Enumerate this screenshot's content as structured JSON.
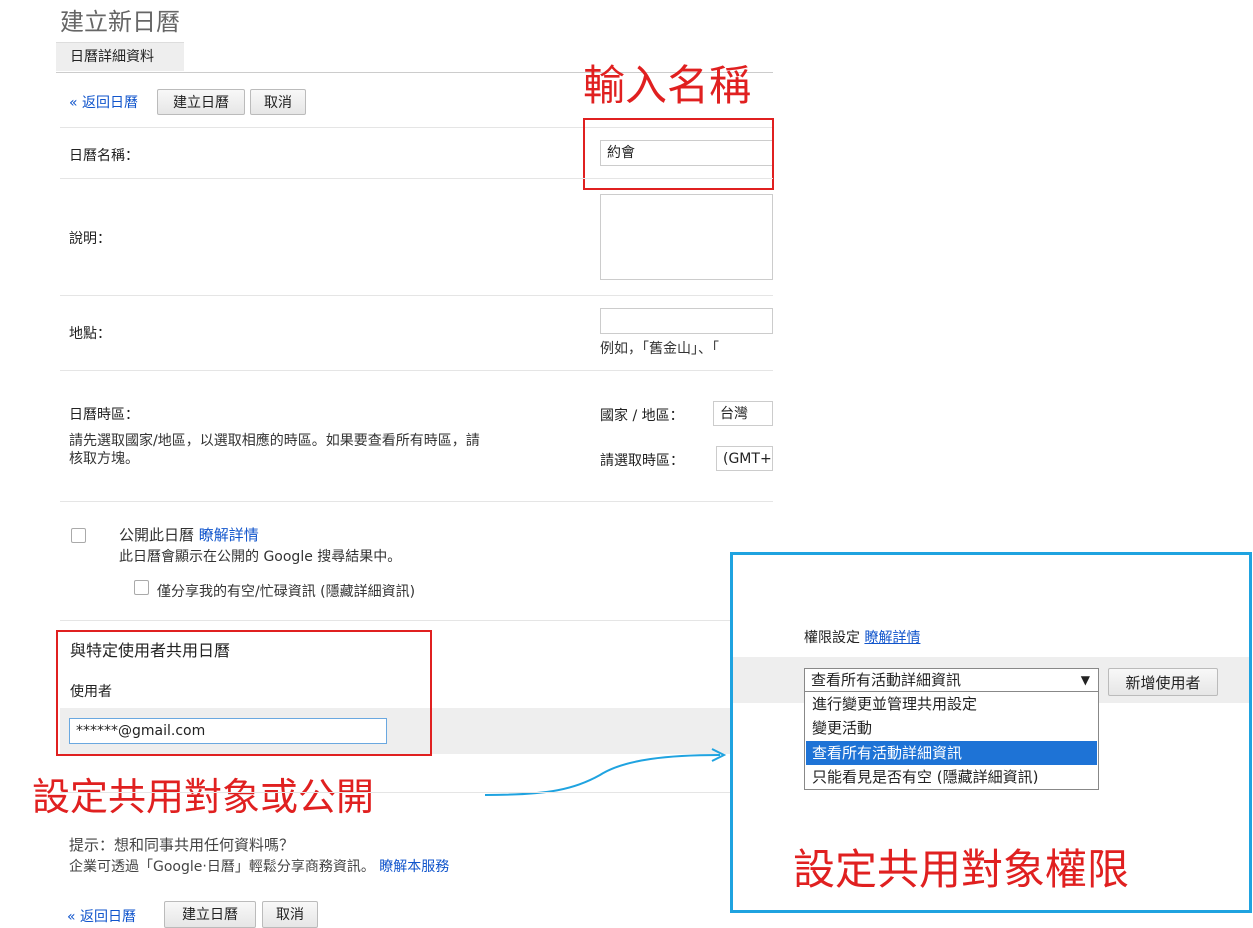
{
  "page": {
    "title": "建立新日曆",
    "tab": "日曆詳細資料",
    "back_link": "« 返回日曆",
    "create_button": "建立日曆",
    "cancel_button": "取消"
  },
  "form": {
    "name_label": "日曆名稱：",
    "name_value": "約會",
    "description_label": "說明：",
    "location_label": "地點：",
    "location_hint": "例如，「舊金山」、「",
    "timezone_label": "日曆時區：",
    "timezone_help_1": "請先選取國家/地區，以選取相應的時區。如果要查看所有時區，請",
    "timezone_help_2": "核取方塊。",
    "country_label": "國家 / 地區：",
    "country_value": "台灣",
    "zone_label": "請選取時區：",
    "zone_value": "(GMT+"
  },
  "public": {
    "label": "公開此日曆",
    "learn_more": "瞭解詳情",
    "desc": "此日曆會顯示在公開的 Google 搜尋結果中。",
    "busy_only": "僅分享我的有空/忙碌資訊 (隱藏詳細資訊)"
  },
  "share": {
    "heading": "與特定使用者共用日曆",
    "user_col": "使用者",
    "email_value": "******@gmail.com"
  },
  "tip": {
    "line1": "提示：想和同事共用任何資料嗎？",
    "line2": "企業可透過「Google‧日曆」輕鬆分享商務資訊。",
    "learn_service": "瞭解本服務"
  },
  "permissions": {
    "label": "權限設定",
    "learn_more": "瞭解詳情",
    "selected": "查看所有活動詳細資訊",
    "add_user": "新增使用者",
    "options": [
      "進行變更並管理共用設定",
      "變更活動",
      "查看所有活動詳細資訊",
      "只能看見是否有空 (隱藏詳細資訊)"
    ]
  },
  "annotations": {
    "enter_name": "輸入名稱",
    "set_share": "設定共用對象或公開",
    "set_permission": "設定共用對象權限"
  }
}
